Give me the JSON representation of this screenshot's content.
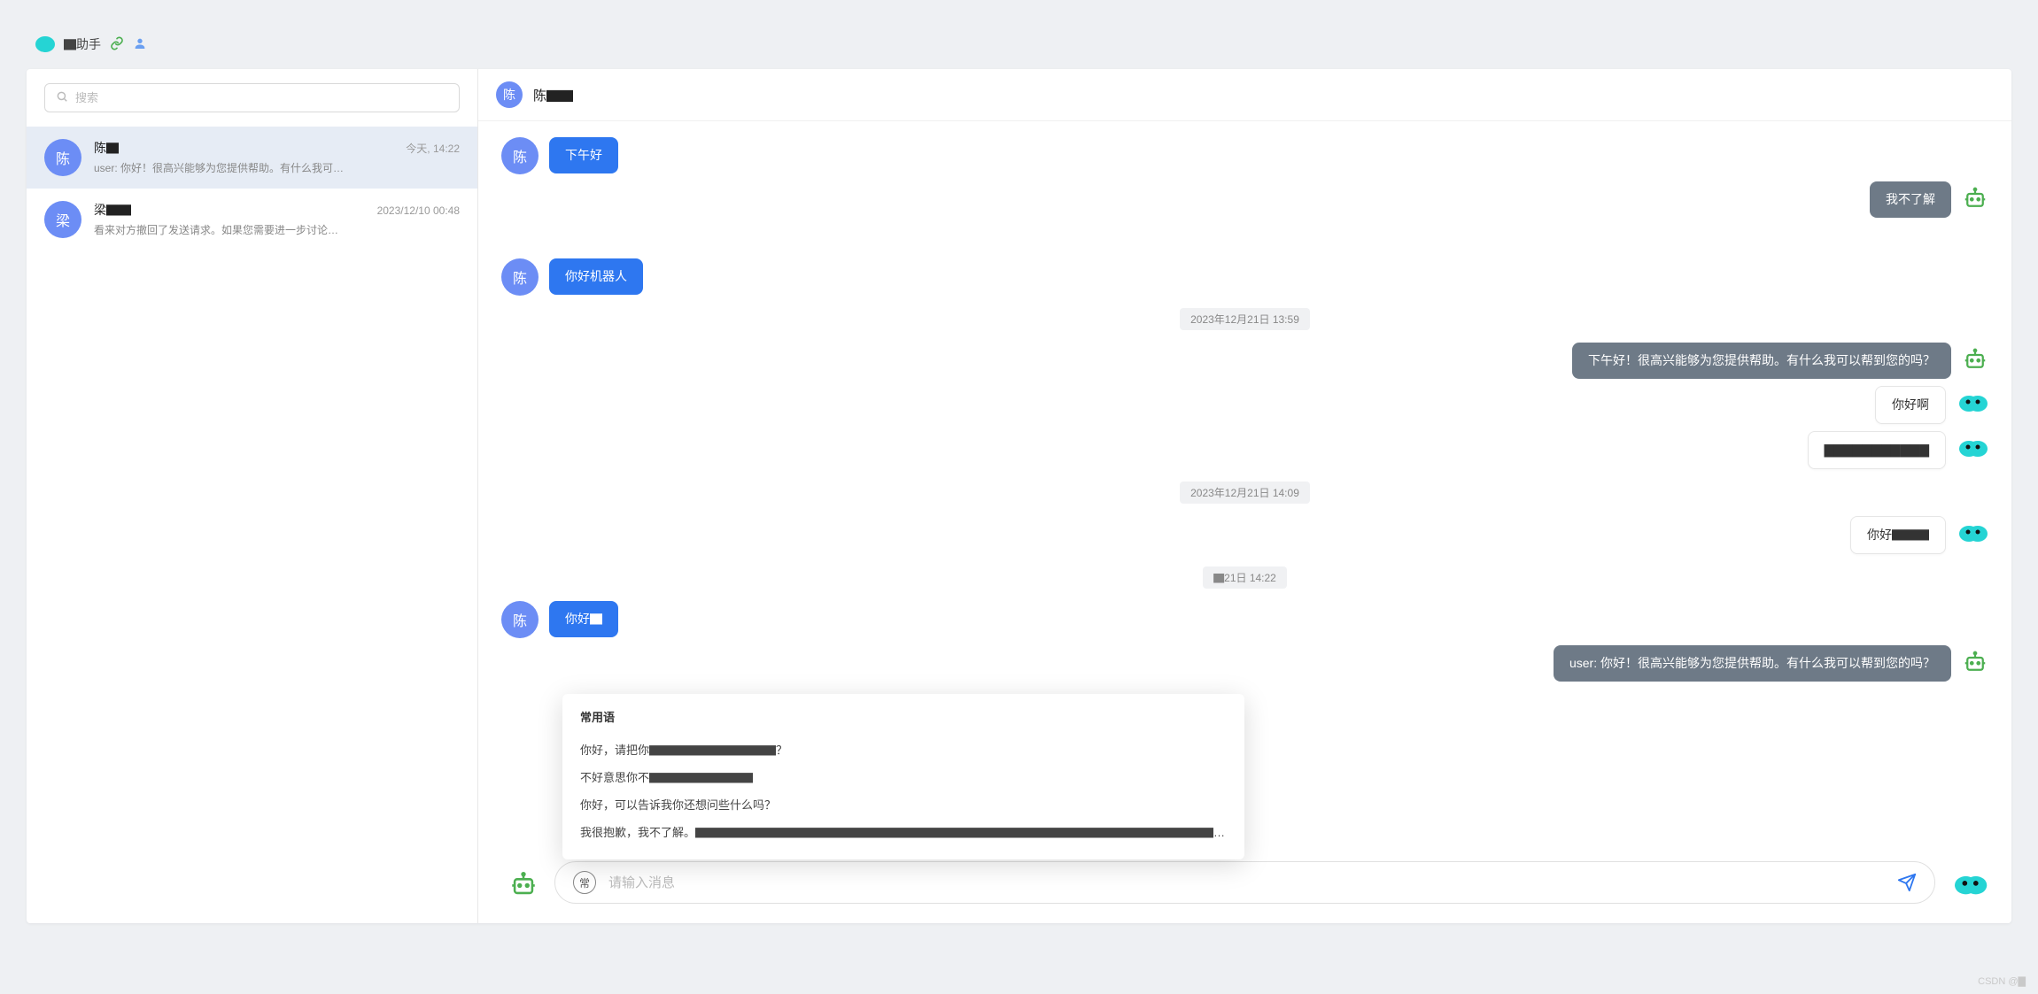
{
  "header": {
    "title": "▇助手"
  },
  "search": {
    "placeholder": "搜索"
  },
  "conversations": [
    {
      "avatar": "陈",
      "name": "陈▇",
      "time": "今天, 14:22",
      "preview": "user: 你好！很高兴能够为您提供帮助。有什么我可…",
      "active": true
    },
    {
      "avatar": "梁",
      "name": "梁▇▇",
      "time": "2023/12/10 00:48",
      "preview": "看来对方撤回了发送请求。如果您需要进一步讨论…",
      "active": false
    }
  ],
  "chat": {
    "header_avatar": "陈",
    "header_title": "陈▇▇",
    "messages": [
      {
        "kind": "left-user",
        "avatar": "陈",
        "text": "下午好"
      },
      {
        "kind": "right-gray",
        "text": "我不了解",
        "avatar_icon": "robot"
      },
      {
        "kind": "left-user",
        "avatar": "陈",
        "text": "你好机器人"
      },
      {
        "kind": "time",
        "text": "2023年12月21日 13:59"
      },
      {
        "kind": "right-gray",
        "text": "下午好！很高兴能够为您提供帮助。有什么我可以帮到您的吗？",
        "avatar_icon": "robot"
      },
      {
        "kind": "right-white",
        "text": "你好啊",
        "avatar_icon": "bot"
      },
      {
        "kind": "right-white",
        "text": "▇▇▇▇▇▇▇▇▇▇▇",
        "avatar_icon": "bot"
      },
      {
        "kind": "time",
        "text": "2023年12月21日 14:09"
      },
      {
        "kind": "right-white",
        "text": "你好▇▇▇",
        "avatar_icon": "bot"
      },
      {
        "kind": "time",
        "text": "▇21日 14:22"
      },
      {
        "kind": "left-user",
        "avatar": "陈",
        "text": "你好▇"
      },
      {
        "kind": "right-gray",
        "text": "user: 你好！很高兴能够为您提供帮助。有什么我可以帮到您的吗？",
        "avatar_icon": "robot"
      }
    ]
  },
  "phrases": {
    "title": "常用语",
    "items": [
      "你好，请把你▇▇▇▇▇▇▇▇▇▇▇？",
      "不好意思你不▇▇▇▇▇▇▇▇▇",
      "你好，可以告诉我你还想问些什么吗？",
      "我很抱歉，我不了解。▇▇▇▇▇▇▇▇▇▇▇▇▇▇▇▇▇▇▇▇▇▇▇▇▇▇▇▇▇▇▇▇▇▇▇▇▇▇▇▇▇▇▇▇▇▇▇"
    ]
  },
  "composer": {
    "placeholder": "请输入消息",
    "trigger": "常"
  },
  "watermark": "CSDN @▇"
}
